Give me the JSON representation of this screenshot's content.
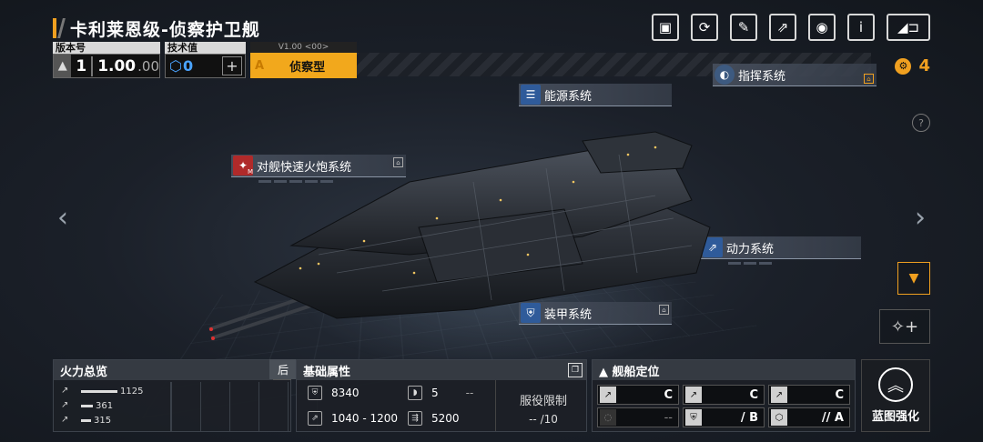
{
  "title": "卡利莱恩级-侦察护卫舰",
  "top_buttons": [
    {
      "name": "gallery-icon",
      "glyph": "▣"
    },
    {
      "name": "refresh-icon",
      "glyph": "⟳"
    },
    {
      "name": "paint-icon",
      "glyph": "✎"
    },
    {
      "name": "share-icon",
      "glyph": "⇗"
    },
    {
      "name": "view-icon",
      "glyph": "◉"
    },
    {
      "name": "info-icon",
      "glyph": "i"
    },
    {
      "name": "back-icon",
      "glyph": "◢⊐"
    }
  ],
  "version": {
    "label": "版本号",
    "tier": "1",
    "main": "1.00",
    "sub": ".00"
  },
  "tech": {
    "label": "技术值",
    "value": "0",
    "plus": "+"
  },
  "role": {
    "version_tag": "V1.00 <00>",
    "grade": "A",
    "label": "侦察型"
  },
  "resource": {
    "value": "4"
  },
  "systems": {
    "command": {
      "name": "指挥系统"
    },
    "energy": {
      "name": "能源系统"
    },
    "weapon": {
      "name": "对舰快速火炮系统",
      "badge": "M"
    },
    "power": {
      "name": "动力系统"
    },
    "armor": {
      "name": "装甲系统"
    }
  },
  "help": "?",
  "nav": {
    "left": "‹",
    "right": "›"
  },
  "firepower": {
    "title": "火力总览",
    "rows": [
      {
        "value": "1125",
        "fraction": 1.0
      },
      {
        "value": "361",
        "fraction": 0.32
      },
      {
        "value": "315",
        "fraction": 0.28
      }
    ],
    "tab_label": "后"
  },
  "base": {
    "title": "基础属性",
    "hp": "8340",
    "slots": "5",
    "slots_extra": "--",
    "dmg": "1040 - 1200",
    "speed": "5200",
    "service_label": "服役限制",
    "service_value": "--  /10"
  },
  "position": {
    "title": "▲ 舰船定位",
    "cells": [
      {
        "value": "C",
        "dim": false
      },
      {
        "value": "C",
        "dim": false
      },
      {
        "value": "C",
        "dim": false
      },
      {
        "value": "--",
        "dim": true
      },
      {
        "value": "/ B",
        "dim": false
      },
      {
        "value": "// A",
        "dim": false
      }
    ]
  },
  "enhance": {
    "label": "蓝图强化"
  }
}
